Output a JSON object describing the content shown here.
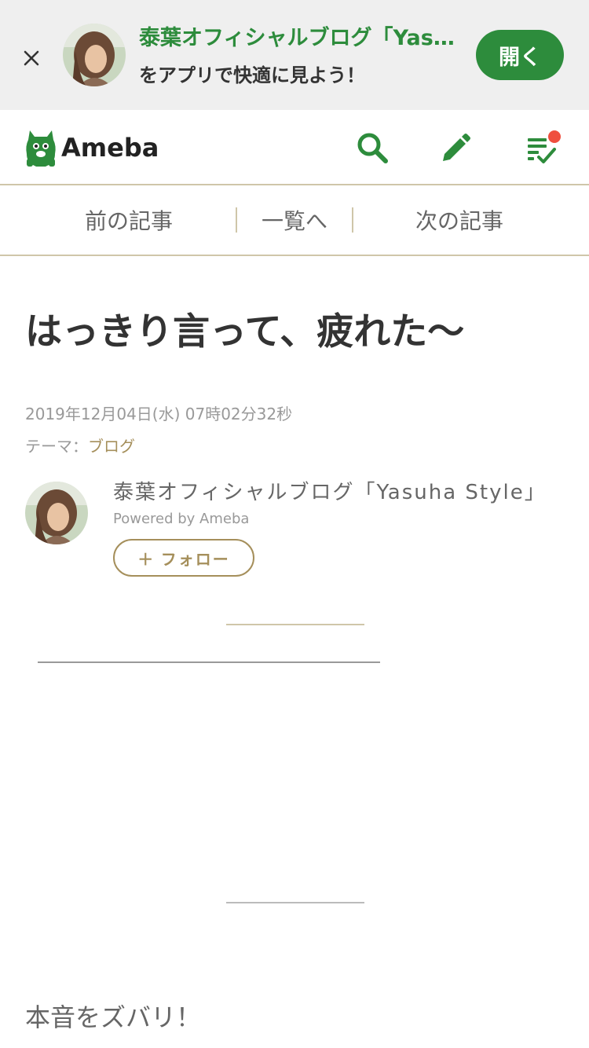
{
  "app_banner": {
    "title": "泰葉オフィシャルブログ「Yasuha Style」",
    "subtitle": "をアプリで快適に見よう！",
    "open_label": "開く",
    "close_icon": "close-icon"
  },
  "header": {
    "logo_text": "Ameba",
    "icons": [
      "search-icon",
      "pencil-icon",
      "checklist-icon"
    ],
    "notification_dot": true
  },
  "pager": {
    "prev_label": "前の記事",
    "list_label": "一覧へ",
    "next_label": "次の記事"
  },
  "article": {
    "title": "はっきり言って、疲れた〜",
    "date": "2019年12月04日(水) 07時02分32秒",
    "theme_prefix": "テーマ：",
    "theme_link": "ブログ",
    "body_first_line": "本音をズバリ！"
  },
  "author": {
    "name": "泰葉オフィシャルブログ「Yasuha Style」",
    "powered_by": "Powered by Ameba",
    "follow_label": "＋ フォロー"
  },
  "colors": {
    "brand_green": "#2d8c3c",
    "gold": "#a58f5b",
    "divider": "#cfc6a9",
    "notification": "#ef4f3e"
  }
}
